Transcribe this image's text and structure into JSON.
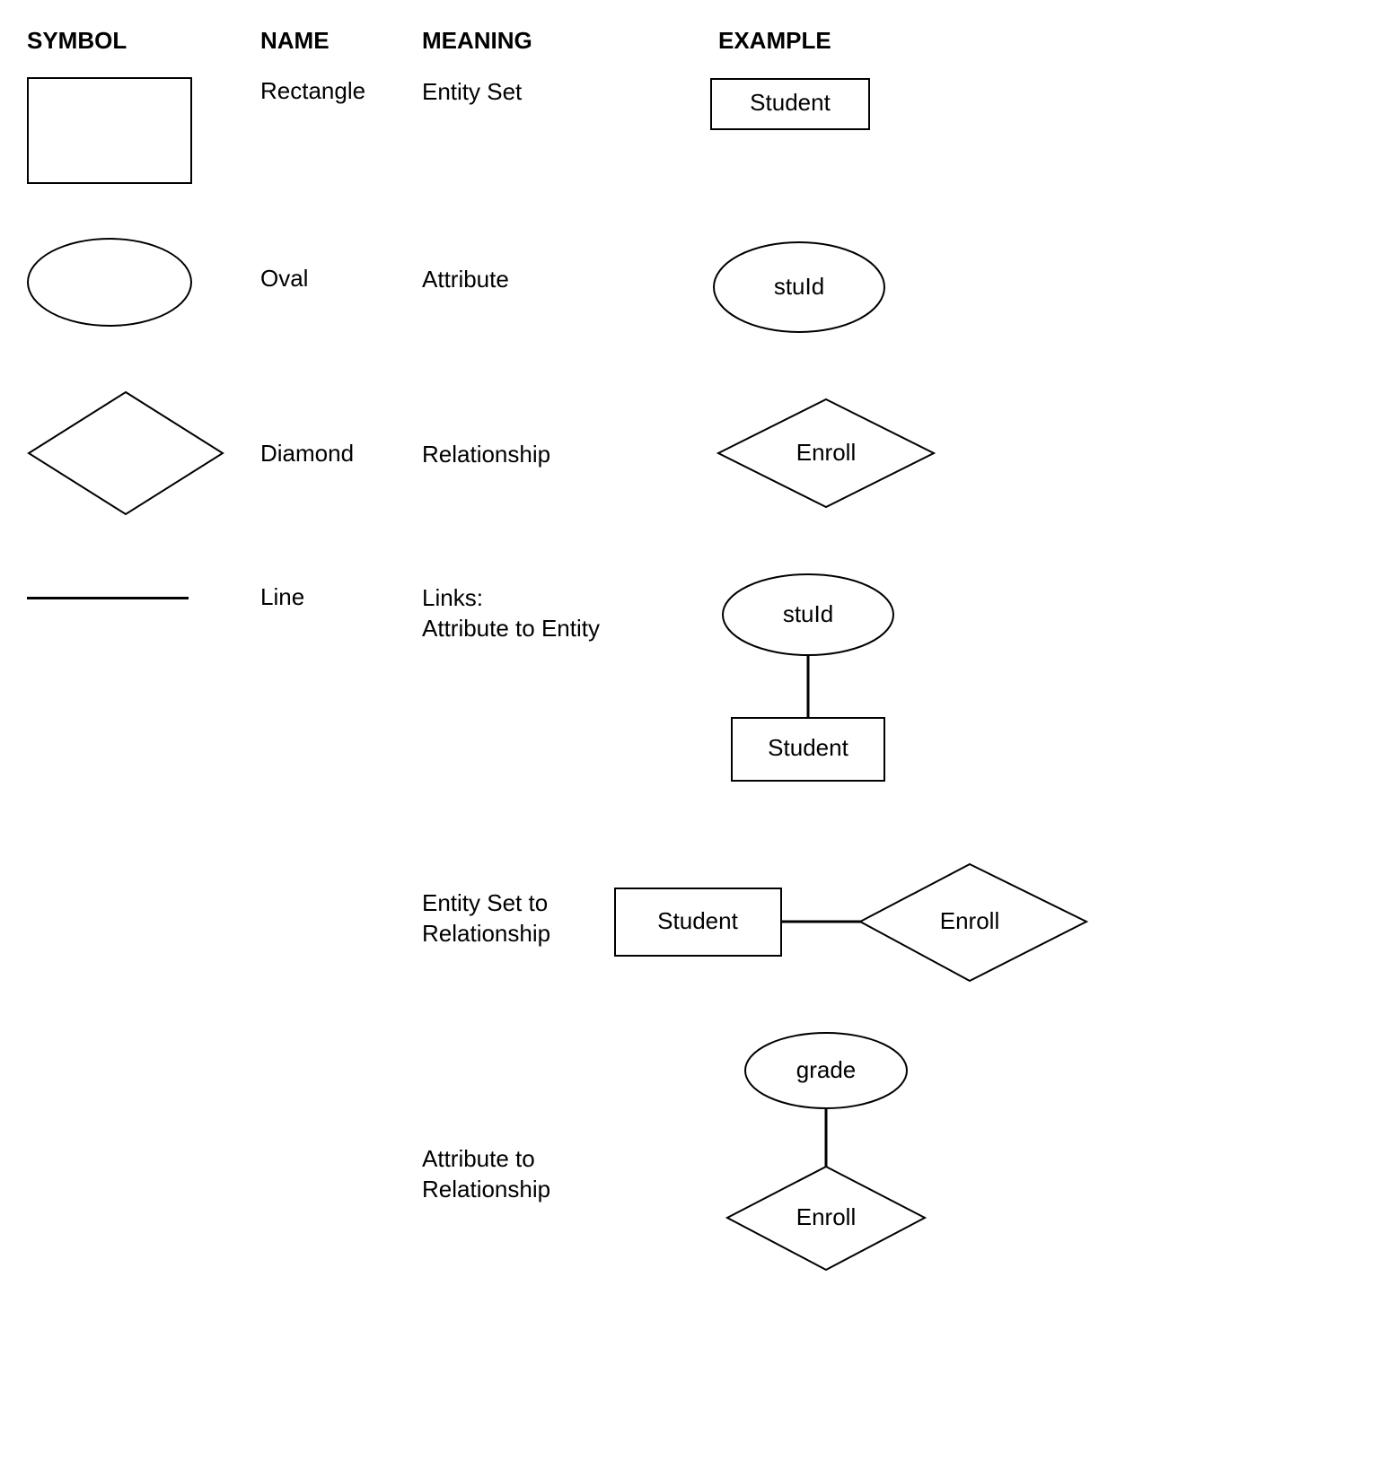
{
  "headers": {
    "symbol": "SYMBOL",
    "name": "NAME",
    "meaning": "MEANING",
    "example": "EXAMPLE"
  },
  "rows": {
    "rectangle": {
      "name": "Rectangle",
      "meaning": "Entity Set",
      "example_label": "Student"
    },
    "oval": {
      "name": "Oval",
      "meaning": "Attribute",
      "example_label": "stuId"
    },
    "diamond": {
      "name": "Diamond",
      "meaning": "Relationship",
      "example_label": "Enroll"
    },
    "line": {
      "name": "Line",
      "meaning_line1": "Links:",
      "meaning_line2": "Attribute to Entity",
      "example_top_label": "stuId",
      "example_bottom_label": "Student"
    },
    "entity_to_relationship": {
      "meaning_line1": "Entity Set to",
      "meaning_line2": "Relationship",
      "left_label": "Student",
      "right_label": "Enroll"
    },
    "attr_to_relationship": {
      "meaning_line1": "Attribute to",
      "meaning_line2": "Relationship",
      "top_label": "grade",
      "bottom_label": "Enroll"
    }
  }
}
